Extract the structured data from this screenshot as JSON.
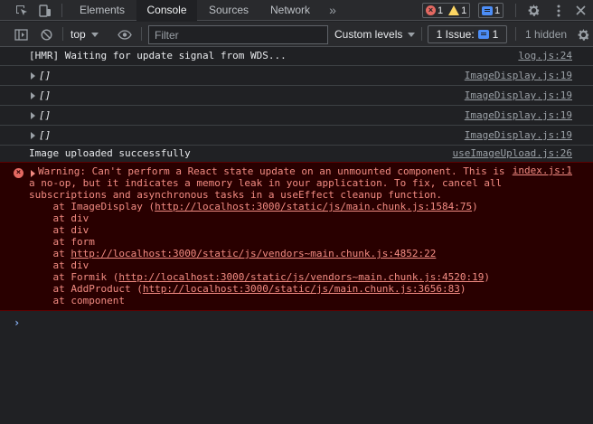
{
  "tabs": {
    "items": [
      {
        "label": "Elements"
      },
      {
        "label": "Console"
      },
      {
        "label": "Sources"
      },
      {
        "label": "Network"
      }
    ],
    "more_label": "»",
    "counters": {
      "errors": "1",
      "warnings": "1",
      "messages": "1"
    }
  },
  "toolbar": {
    "context": "top",
    "filter_placeholder": "Filter",
    "levels_label": "Custom levels",
    "issues_label": "1 Issue:",
    "issues_count": "1",
    "hidden_label": "1 hidden"
  },
  "console": {
    "rows": [
      {
        "text": "[HMR] Waiting for update signal from WDS...",
        "source": "log.js:24"
      },
      {
        "text": "[]",
        "source": "ImageDisplay.js:19"
      },
      {
        "text": "[]",
        "source": "ImageDisplay.js:19"
      },
      {
        "text": "[]",
        "source": "ImageDisplay.js:19"
      },
      {
        "text": "[]",
        "source": "ImageDisplay.js:19"
      },
      {
        "text": "Image uploaded successfully",
        "source": "useImageUpload.js:26"
      }
    ],
    "error": {
      "source": "index.js:1",
      "line1": "Warning: Can't perform a React state update on an unmounted component. This is",
      "line2": "a no-op, but it indicates a memory leak in your application. To fix, cancel all",
      "line3": "subscriptions and asynchronous tasks in a useEffect cleanup function.",
      "stack": [
        {
          "prefix": "    at ImageDisplay (",
          "link": "http://localhost:3000/static/js/main.chunk.js:1584:75",
          "suffix": ")"
        },
        {
          "prefix": "    at div",
          "link": "",
          "suffix": ""
        },
        {
          "prefix": "    at div",
          "link": "",
          "suffix": ""
        },
        {
          "prefix": "    at form",
          "link": "",
          "suffix": ""
        },
        {
          "prefix": "    at ",
          "link": "http://localhost:3000/static/js/vendors~main.chunk.js:4852:22",
          "suffix": ""
        },
        {
          "prefix": "    at div",
          "link": "",
          "suffix": ""
        },
        {
          "prefix": "    at Formik (",
          "link": "http://localhost:3000/static/js/vendors~main.chunk.js:4520:19",
          "suffix": ")"
        },
        {
          "prefix": "    at AddProduct (",
          "link": "http://localhost:3000/static/js/main.chunk.js:3656:83",
          "suffix": ")"
        },
        {
          "prefix": "    at component",
          "link": "",
          "suffix": ""
        }
      ]
    },
    "prompt": "›"
  }
}
